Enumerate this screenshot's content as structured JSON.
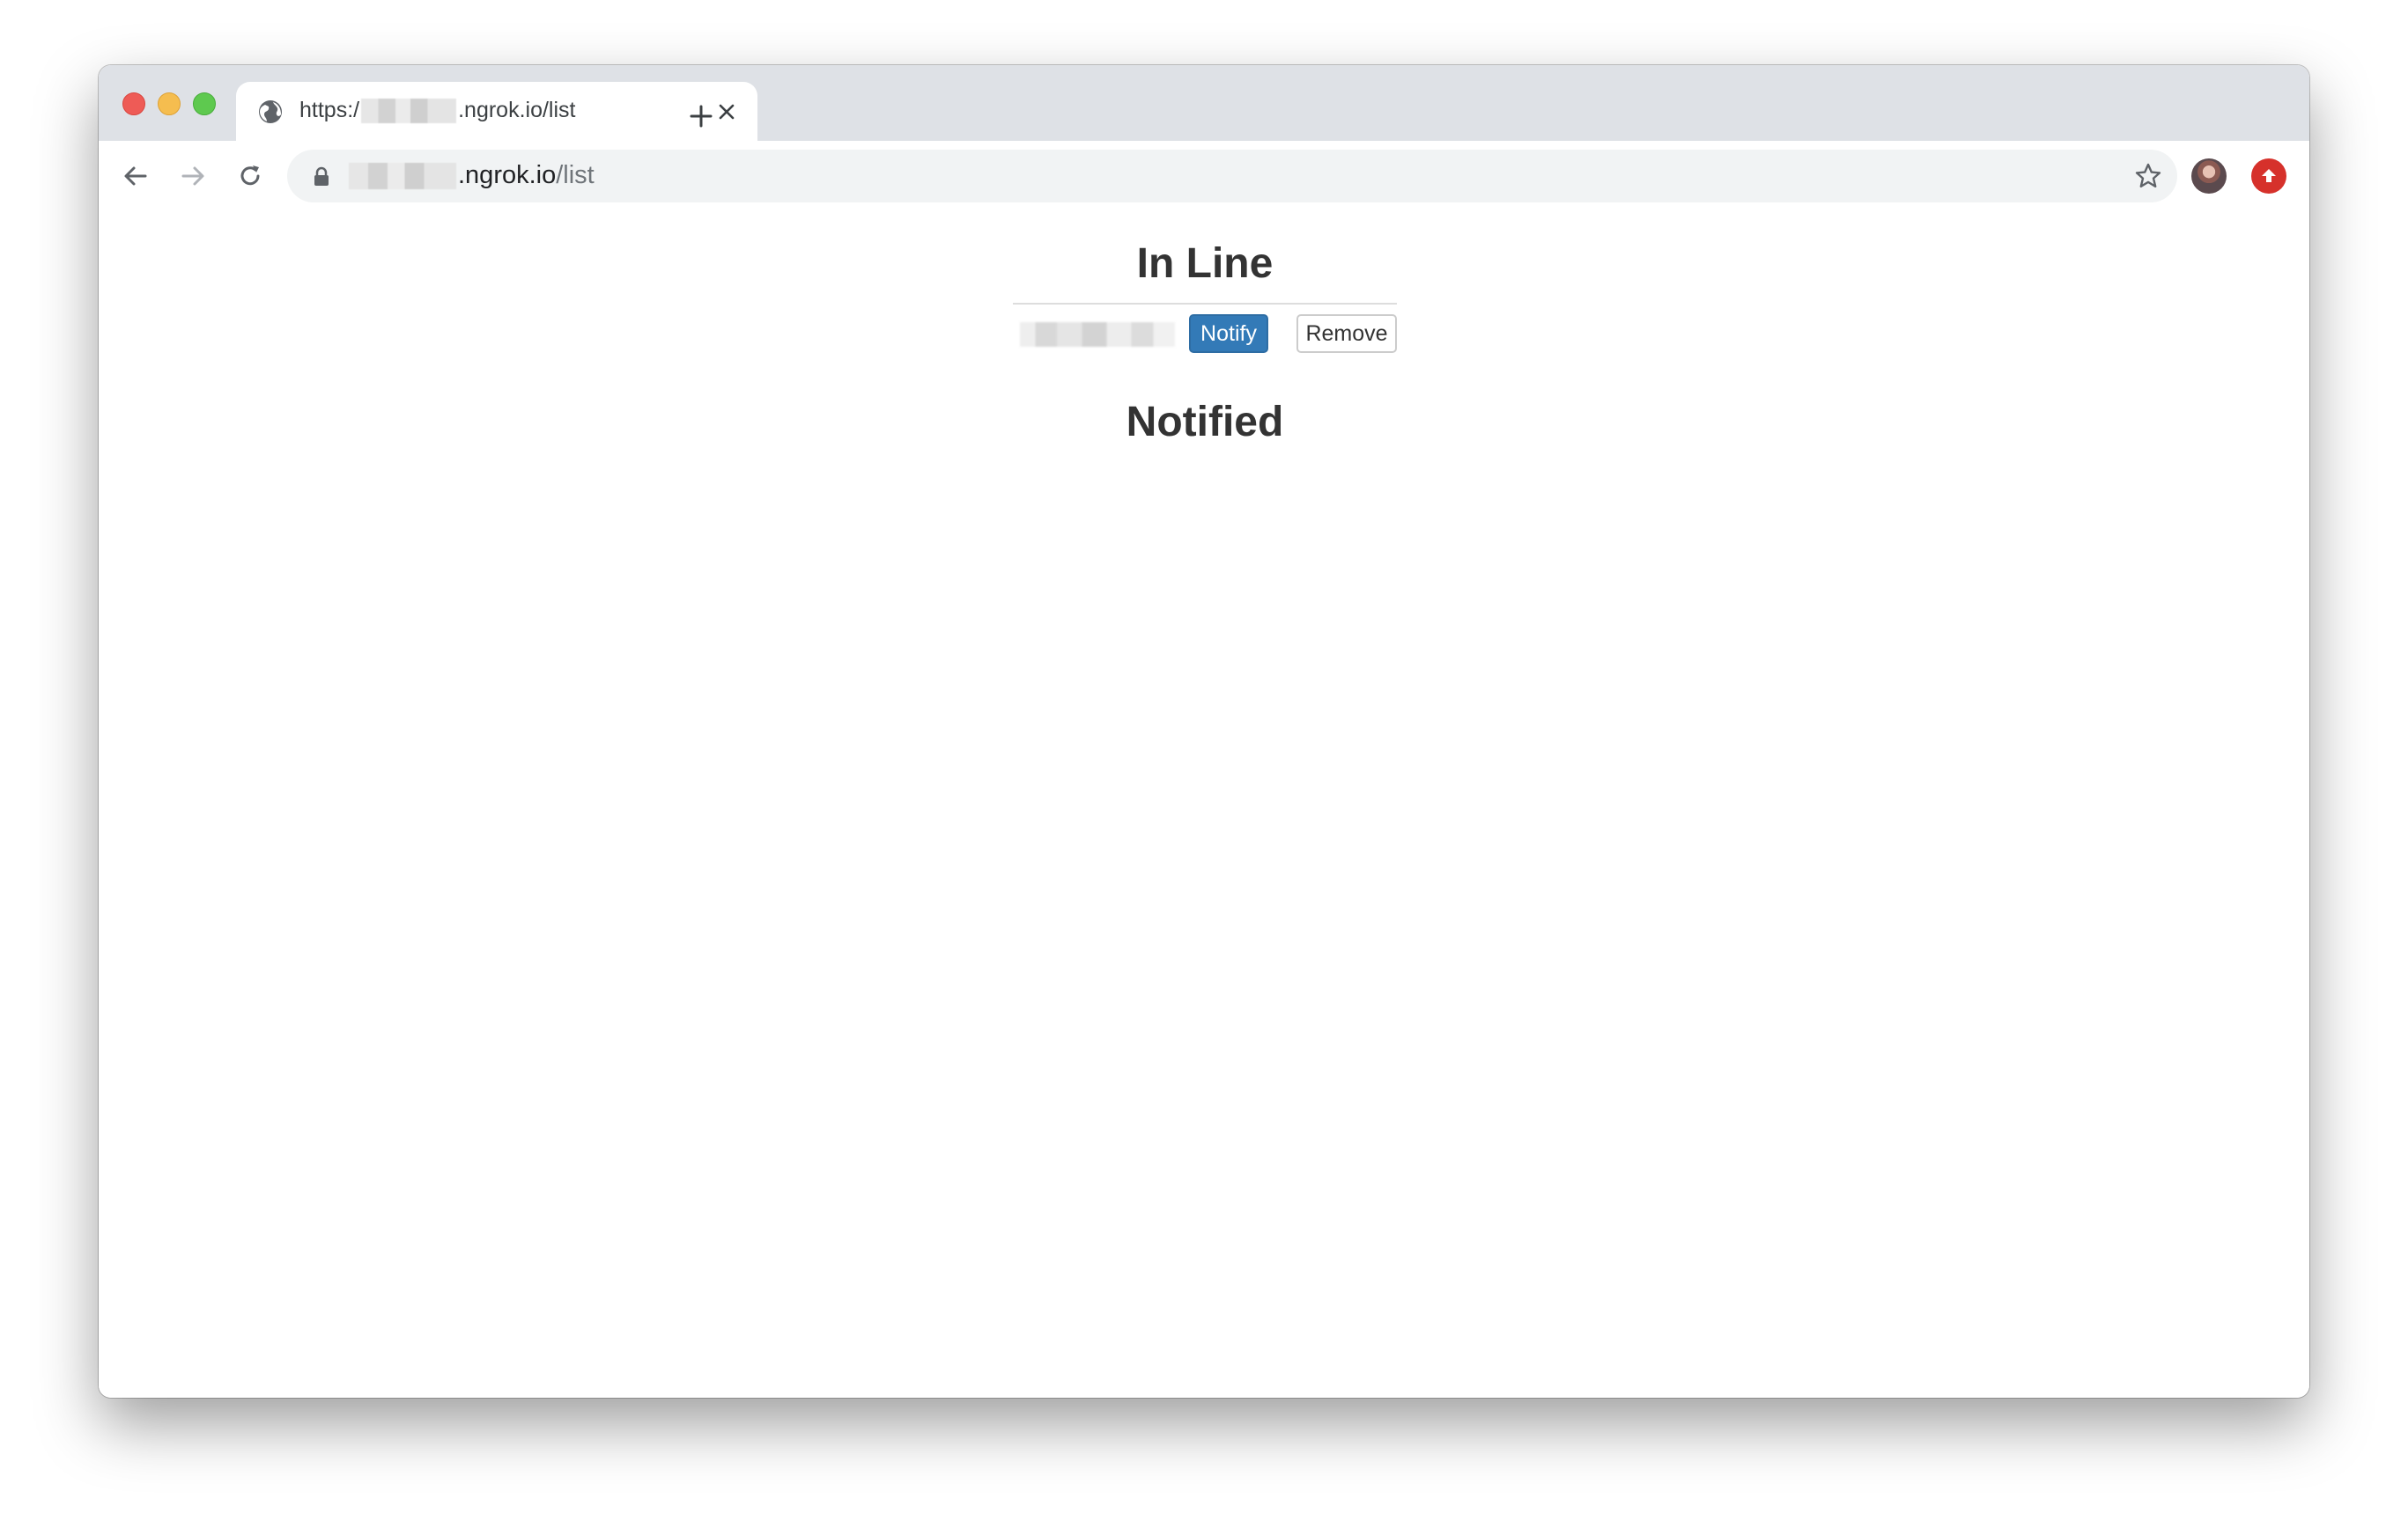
{
  "browser": {
    "tab": {
      "title_prefix": "https:/",
      "title_suffix": ".ngrok.io/list"
    },
    "address_bar": {
      "host_suffix": ".ngrok.io",
      "path": "/list"
    },
    "icons": {
      "favicon": "globe-icon",
      "tab_close": "close-icon",
      "new_tab": "plus-icon",
      "back": "arrow-left-icon",
      "forward": "arrow-right-icon",
      "reload": "reload-icon",
      "lock": "lock-icon",
      "bookmark": "star-icon",
      "extension": "upload-arrow-icon"
    }
  },
  "page": {
    "in_line": {
      "heading": "In Line",
      "entries": [
        {
          "notify_label": "Notify",
          "remove_label": "Remove"
        }
      ]
    },
    "notified": {
      "heading": "Notified"
    }
  },
  "colors": {
    "notify_button": "#337ab7",
    "heading_text": "#333333",
    "tab_strip": "#dee1e6",
    "omnibox": "#f1f3f4"
  }
}
